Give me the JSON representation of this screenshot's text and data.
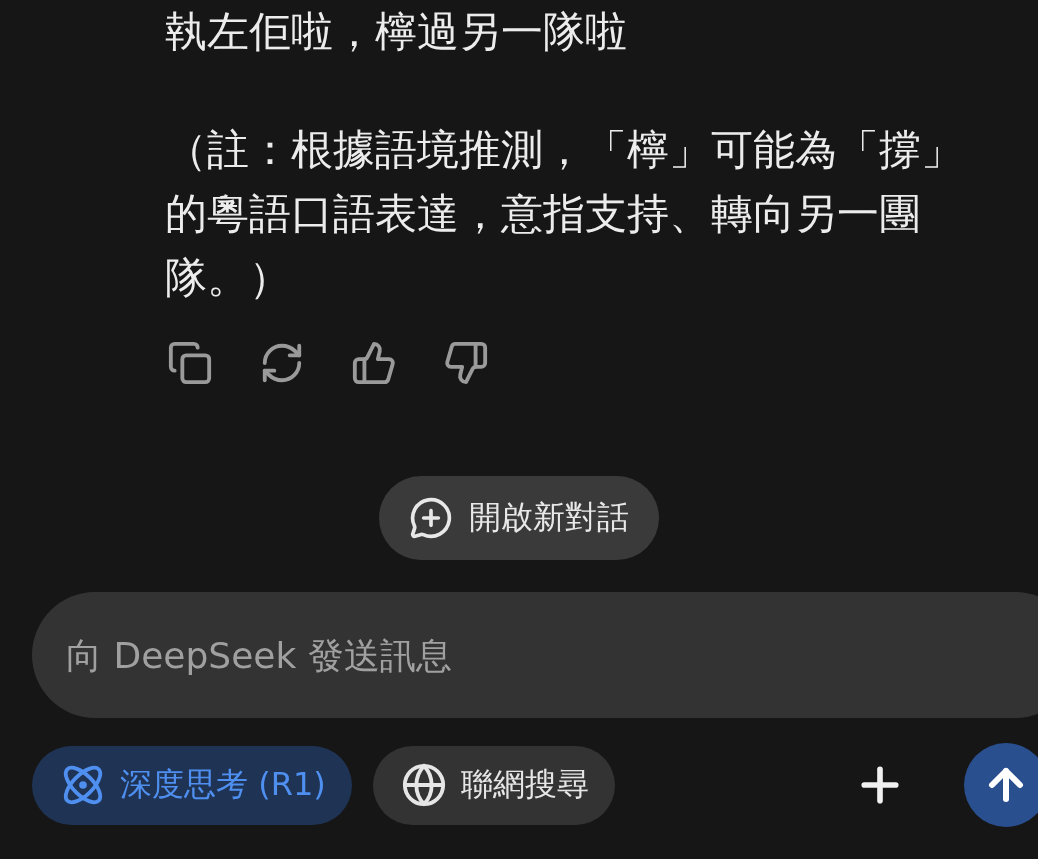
{
  "message": {
    "paragraphs": [
      "執左佢啦，檸過另一隊啦",
      "（註：根據語境推測，「檸」可能為「撐」的粵語口語表達，意指支持、轉向另一團隊。）"
    ]
  },
  "new_chat": {
    "label": "開啟新對話"
  },
  "composer": {
    "placeholder": "向 DeepSeek 發送訊息"
  },
  "options": [
    {
      "kind": "deep-think",
      "label": "深度思考 (R1)",
      "selected": true
    },
    {
      "kind": "web-search",
      "label": "聯網搜尋",
      "selected": false
    }
  ]
}
